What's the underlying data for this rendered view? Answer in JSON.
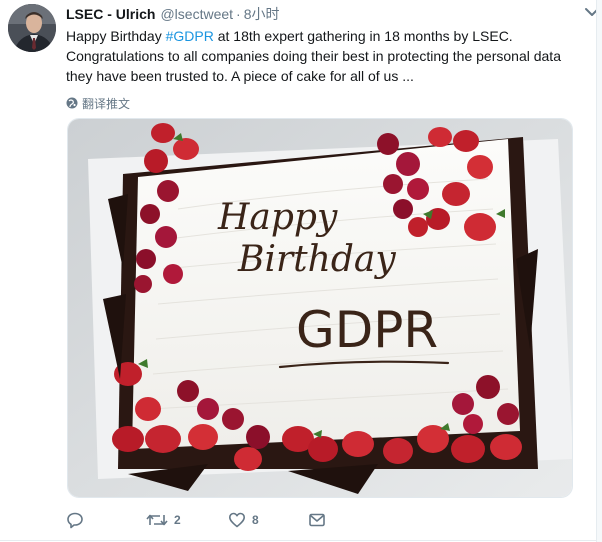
{
  "tweet": {
    "author_name": "LSEC - Ulrich",
    "author_handle": "@lsectweet",
    "separator": "·",
    "time": "8小时",
    "text_before": "Happy Birthday ",
    "hashtag": "#GDPR",
    "text_after": " at 18th expert gathering in 18 months by LSEC. Congratulations to all companies doing their best in protecting the personal data they have been trusted to. A piece of cake for all of us ...",
    "translate_label": "翻译推文"
  },
  "cake": {
    "line1": "Happy",
    "line2": "Birthday",
    "line3": "GDPR"
  },
  "actions": {
    "reply_count": "",
    "retweet_count": "2",
    "like_count": "8"
  },
  "icons": {
    "reply": "reply-icon",
    "retweet": "retweet-icon",
    "like": "heart-icon",
    "dm": "envelope-icon",
    "translate": "globe-icon",
    "menu": "chevron-down-icon"
  },
  "colors": {
    "link": "#1b95e0",
    "meta": "#657786",
    "text": "#14171a"
  }
}
